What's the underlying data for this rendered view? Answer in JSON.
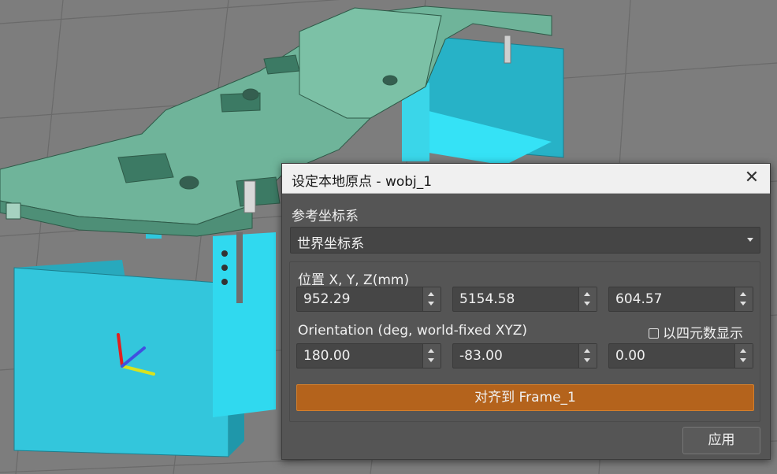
{
  "dialog": {
    "title": "设定本地原点 - wobj_1",
    "close_icon": "close-icon",
    "reference_frame_label": "参考坐标系",
    "reference_frame_value": "世界坐标系",
    "position_label": "位置 X, Y, Z(mm)",
    "position": {
      "x": "952.29",
      "y": "5154.58",
      "z": "604.57"
    },
    "orientation_label": "Orientation (deg, world-fixed XYZ)",
    "quaternion_label": "以四元数显示",
    "quaternion_checked": false,
    "orientation": {
      "x": "180.00",
      "y": "-83.00",
      "z": "0.00"
    },
    "align_button": "对齐到 Frame_1",
    "apply_button": "应用"
  },
  "colors": {
    "viewport_bg": "#7d7d7d",
    "part_green": "#6fb49a",
    "fixture_cyan": "#33d2e6",
    "dialog_bg": "#555555",
    "accent_orange": "#b4631c",
    "axis_x": "#e02020",
    "axis_y": "#d8e21e",
    "axis_z": "#4050e0"
  }
}
